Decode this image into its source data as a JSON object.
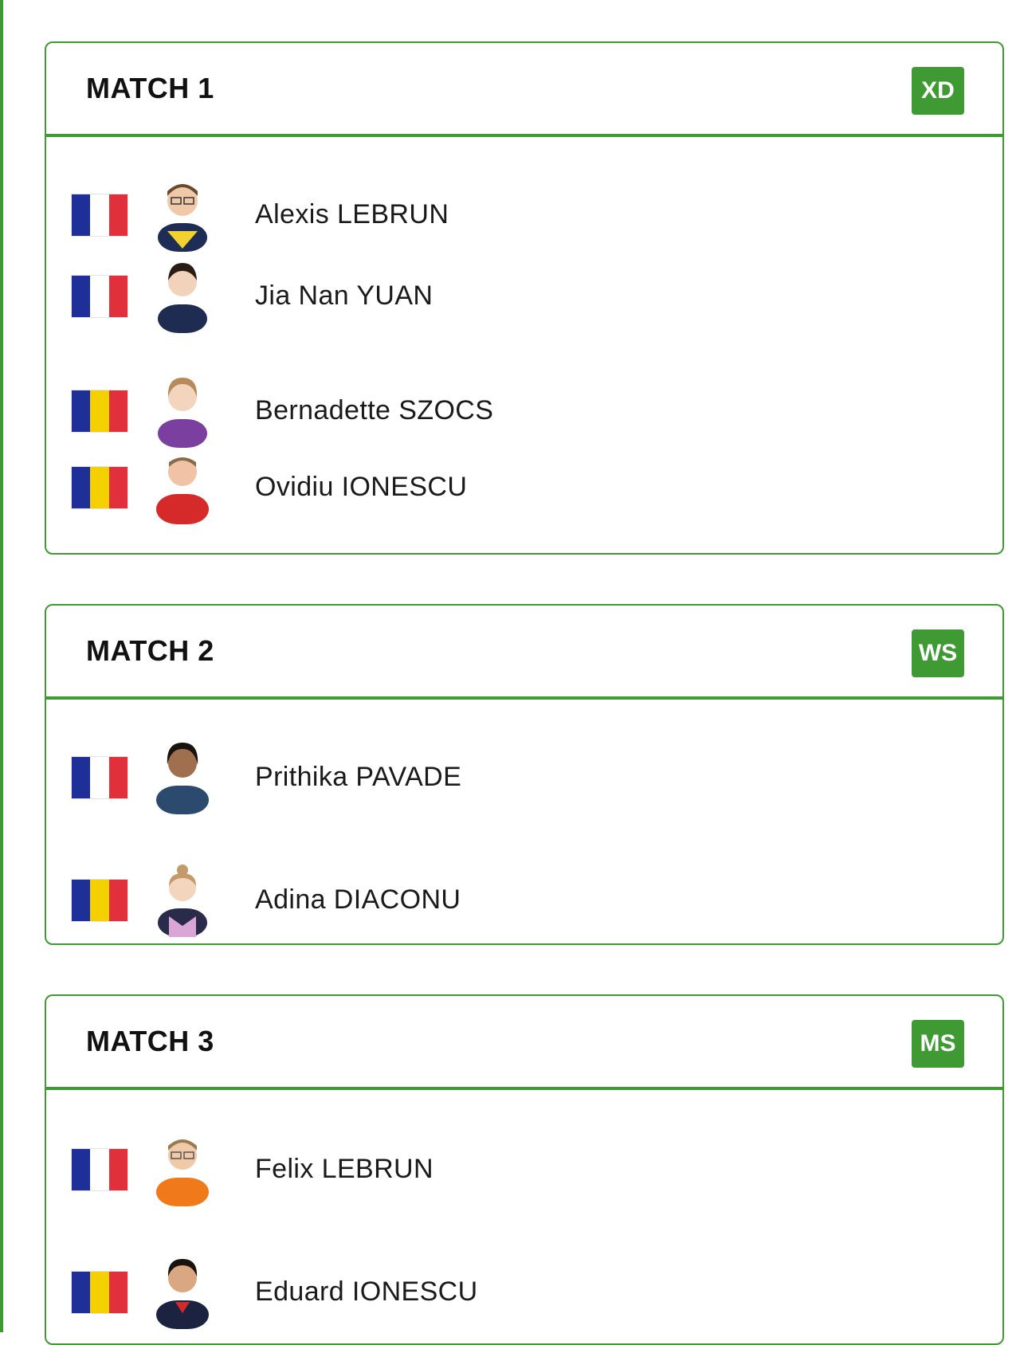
{
  "colors": {
    "accent": "#3f9a33"
  },
  "flags": {
    "fr": [
      "#1f2f9a",
      "#ffffff",
      "#e0303c"
    ],
    "ro": [
      "#1f2f9a",
      "#f5d000",
      "#e0303c"
    ]
  },
  "matches": [
    {
      "title": "MATCH 1",
      "badge": "XD",
      "players": [
        {
          "name": "Alexis LEBRUN",
          "flag": "fr",
          "icon": "player-avatar"
        },
        {
          "name": "Jia Nan YUAN",
          "flag": "fr",
          "icon": "player-avatar"
        },
        {
          "name": "Bernadette SZOCS",
          "flag": "ro",
          "icon": "player-avatar"
        },
        {
          "name": "Ovidiu IONESCU",
          "flag": "ro",
          "icon": "player-avatar"
        }
      ]
    },
    {
      "title": "MATCH 2",
      "badge": "WS",
      "players": [
        {
          "name": "Prithika PAVADE",
          "flag": "fr",
          "icon": "player-avatar"
        },
        {
          "name": "Adina DIACONU",
          "flag": "ro",
          "icon": "player-avatar"
        }
      ]
    },
    {
      "title": "MATCH 3",
      "badge": "MS",
      "players": [
        {
          "name": "Felix LEBRUN",
          "flag": "fr",
          "icon": "player-avatar"
        },
        {
          "name": "Eduard IONESCU",
          "flag": "ro",
          "icon": "player-avatar"
        }
      ]
    }
  ]
}
